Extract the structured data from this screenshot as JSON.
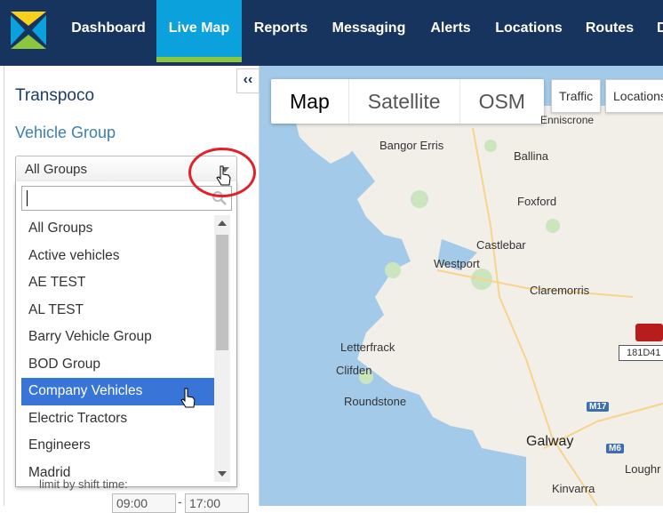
{
  "nav": {
    "items": [
      {
        "label": "Dashboard",
        "active": false
      },
      {
        "label": "Live Map",
        "active": true
      },
      {
        "label": "Reports",
        "active": false
      },
      {
        "label": "Messaging",
        "active": false
      },
      {
        "label": "Alerts",
        "active": false
      },
      {
        "label": "Locations",
        "active": false
      },
      {
        "label": "Routes",
        "active": false
      },
      {
        "label": "D",
        "active": false
      }
    ],
    "colors": {
      "background": "#16345e",
      "active": "#0aa1dd",
      "accent": "#8cc63f"
    }
  },
  "sidebar": {
    "collapse_label": "‹‹",
    "company": "Transpoco",
    "group_heading": "Vehicle Group",
    "select": {
      "value": "All Groups"
    },
    "dropdown": {
      "search_value": "",
      "items": [
        {
          "label": "All Groups",
          "selected": false
        },
        {
          "label": "Active vehicles",
          "selected": false
        },
        {
          "label": "AE TEST",
          "selected": false
        },
        {
          "label": "AL TEST",
          "selected": false
        },
        {
          "label": "Barry Vehicle Group",
          "selected": false
        },
        {
          "label": "BOD Group",
          "selected": false
        },
        {
          "label": "Company Vehicles",
          "selected": true
        },
        {
          "label": "Electric Tractors",
          "selected": false
        },
        {
          "label": "Engineers",
          "selected": false
        },
        {
          "label": "Madrid",
          "selected": false
        }
      ]
    },
    "bottom_text": "limit by shift time:",
    "time_start": "09:00",
    "time_end": "17:00",
    "time_sep": "-"
  },
  "map": {
    "type_buttons": [
      {
        "label": "Map",
        "active": true
      },
      {
        "label": "Satellite",
        "active": false
      },
      {
        "label": "OSM",
        "active": false
      }
    ],
    "traffic_label": "Traffic",
    "locations_label": "Locations",
    "places": [
      "Bangor Erris",
      "Ballina",
      "Foxford",
      "Castlebar",
      "Westport",
      "Claremorris",
      "Letterfrack",
      "Clifden",
      "Roundstone",
      "Galway",
      "Loughr",
      "Kinvarra",
      "Enniscrone"
    ],
    "roads": [
      "M17",
      "M6"
    ],
    "vehicle_label": "181D41"
  }
}
